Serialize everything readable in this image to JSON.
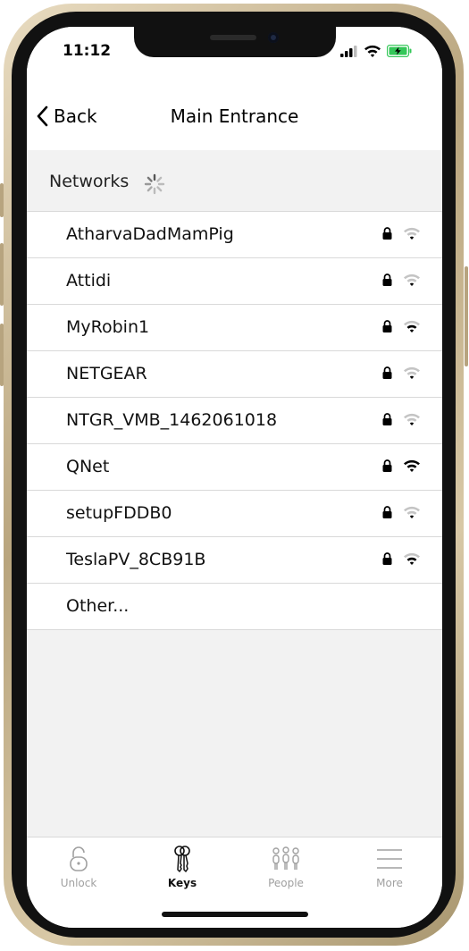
{
  "status_bar": {
    "time": "11:12"
  },
  "nav": {
    "back_label": "Back",
    "title": "Main Entrance"
  },
  "section": {
    "label": "Networks"
  },
  "networks": [
    {
      "name": "AtharvaDadMamPig",
      "secured": true,
      "signal": 1
    },
    {
      "name": "Attidi",
      "secured": true,
      "signal": 1
    },
    {
      "name": "MyRobin1",
      "secured": true,
      "signal": 2
    },
    {
      "name": "NETGEAR",
      "secured": true,
      "signal": 1
    },
    {
      "name": "NTGR_VMB_1462061018",
      "secured": true,
      "signal": 1
    },
    {
      "name": "QNet",
      "secured": true,
      "signal": 3
    },
    {
      "name": "setupFDDB0",
      "secured": true,
      "signal": 1
    },
    {
      "name": "TeslaPV_8CB91B",
      "secured": true,
      "signal": 2
    }
  ],
  "other_label": "Other...",
  "tabs": [
    {
      "label": "Unlock",
      "icon": "padlock-icon",
      "active": false
    },
    {
      "label": "Keys",
      "icon": "keys-icon",
      "active": true
    },
    {
      "label": "People",
      "icon": "people-icon",
      "active": false
    },
    {
      "label": "More",
      "icon": "menu-icon",
      "active": false
    }
  ],
  "colors": {
    "battery": "#34c759",
    "inactive": "#a0a0a0",
    "divider": "#d9d9d9",
    "header_bg": "#f2f2f2"
  }
}
